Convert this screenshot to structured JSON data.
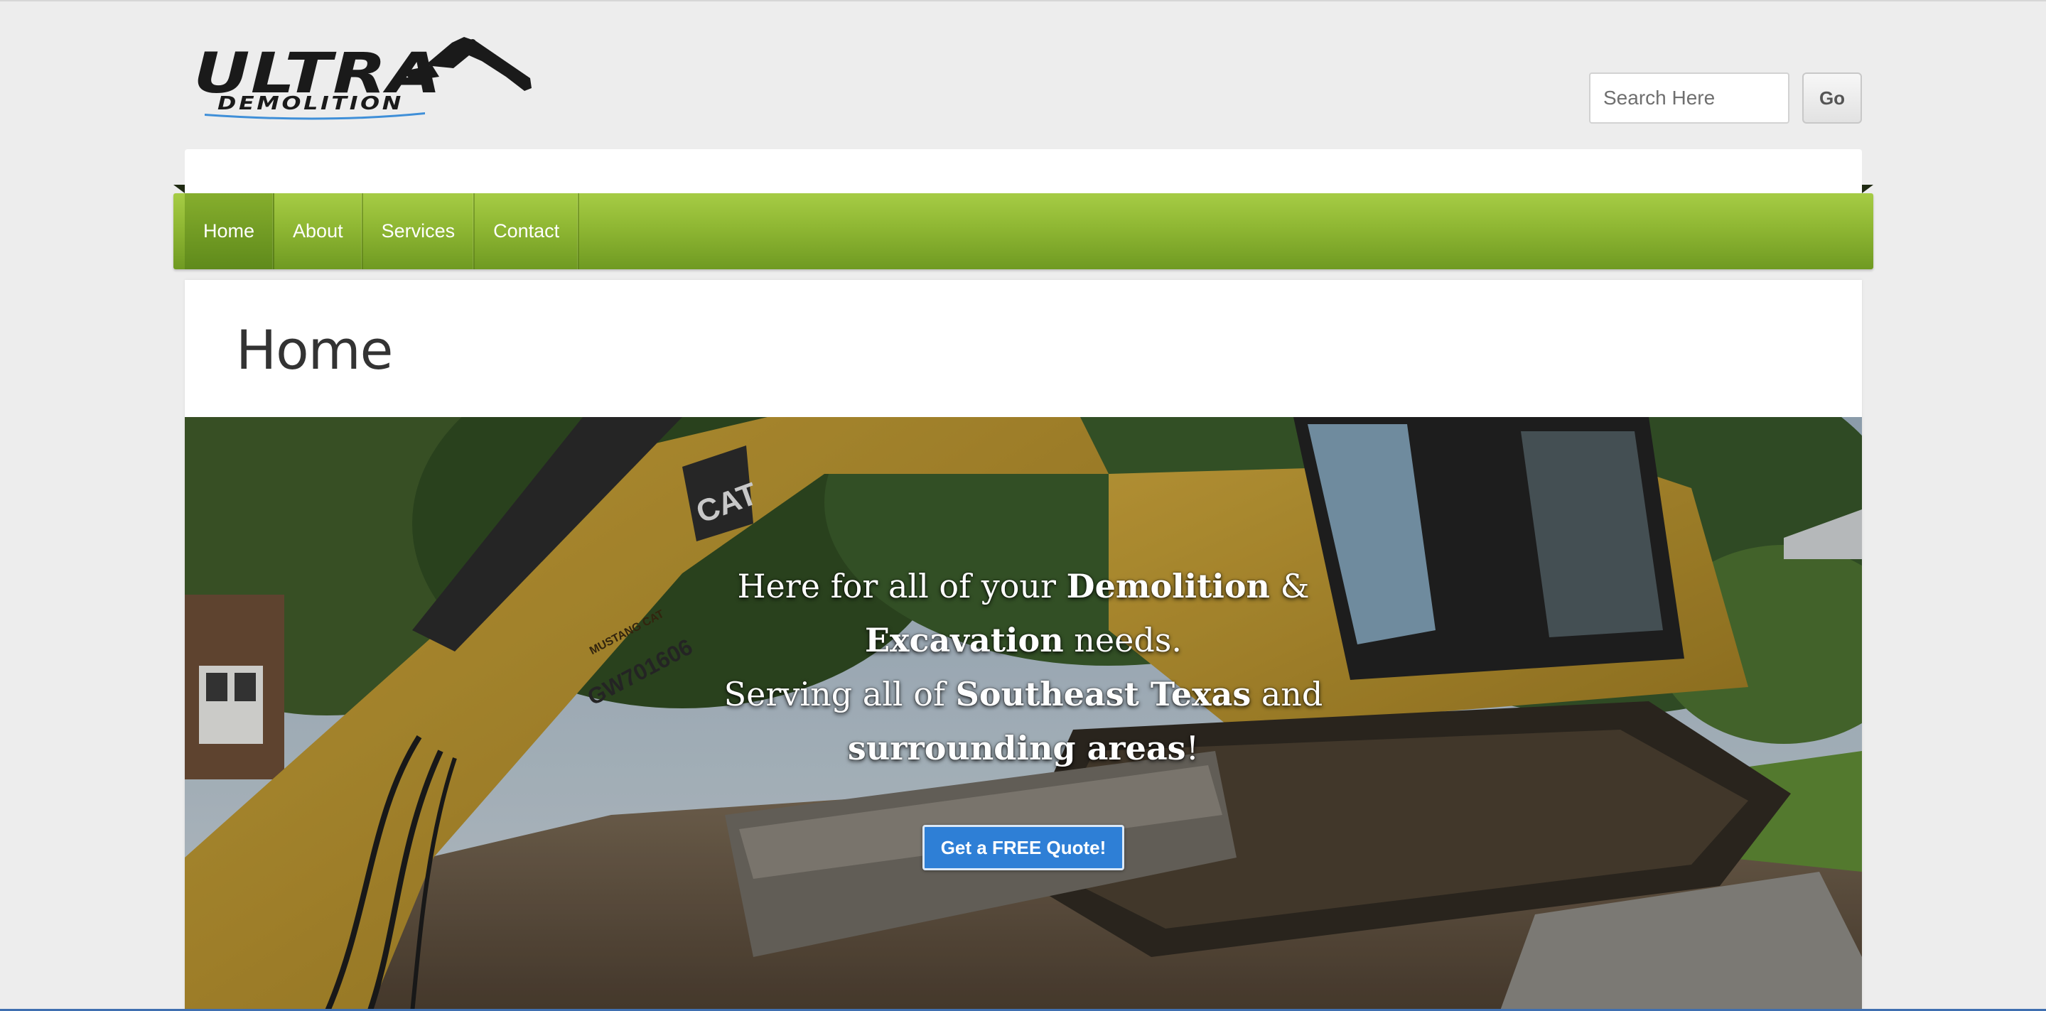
{
  "header": {
    "logo": {
      "primary_text": "ULTRA",
      "secondary_text": "DEMOLITION",
      "icon": "excavator-arm-icon"
    },
    "search": {
      "placeholder": "Search Here",
      "value": "",
      "button_label": "Go"
    }
  },
  "nav": {
    "items": [
      {
        "label": "Home",
        "active": true
      },
      {
        "label": "About",
        "active": false
      },
      {
        "label": "Services",
        "active": false
      },
      {
        "label": "Contact",
        "active": false
      }
    ]
  },
  "main": {
    "title": "Home",
    "hero": {
      "line1_pre": "Here for all of your ",
      "line1_bold": "Demolition",
      "line1_post": " &",
      "line2_bold": "Excavation",
      "line2_post": " needs.",
      "line3_pre": "Serving all of ",
      "line3_bold": "Southeast Texas",
      "line3_post": " and",
      "line4_bold": "surrounding areas",
      "line4_post": "!",
      "cta_label": "Get a FREE Quote!",
      "machine_brand": "CAT",
      "machine_tag": "MUSTANG CAT",
      "machine_id": "GW701606"
    }
  },
  "colors": {
    "nav_green": "#8fb733",
    "cta_blue": "#2e7fd6",
    "logo_black": "#1a1a1a",
    "logo_blue_swoosh": "#3f8fd8"
  }
}
